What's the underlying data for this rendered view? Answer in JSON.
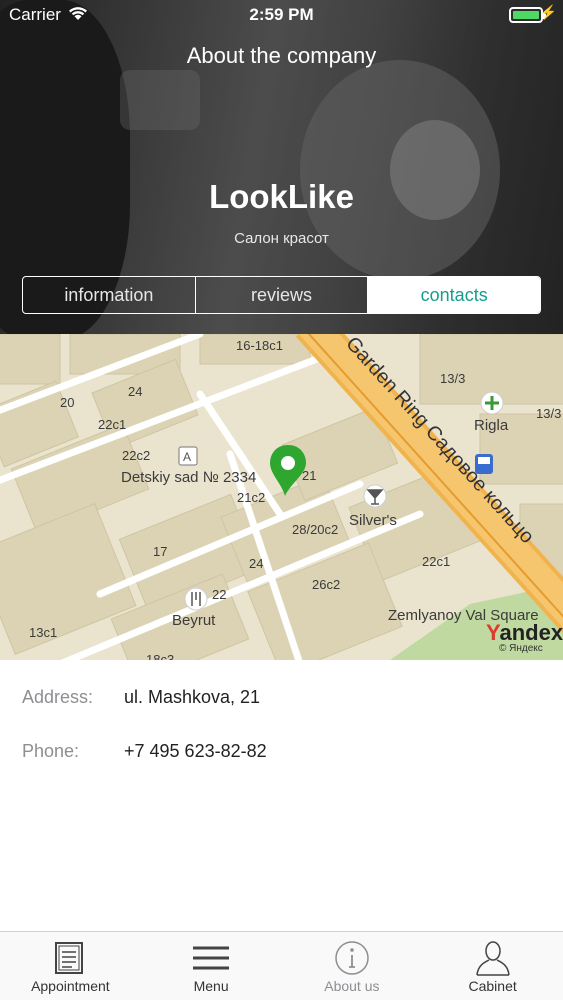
{
  "status_bar": {
    "carrier": "Carrier",
    "time": "2:59 PM",
    "battery_color": "#4cd964"
  },
  "nav": {
    "title": "About the company"
  },
  "company": {
    "name": "LookLike",
    "subtitle": "Салон красот"
  },
  "segments": [
    {
      "label": "information",
      "active": false
    },
    {
      "label": "reviews",
      "active": false
    },
    {
      "label": "contacts",
      "active": true
    }
  ],
  "accent_color": "#139e8e",
  "map": {
    "labels": [
      {
        "text": "16-18c1"
      },
      {
        "text": "24"
      },
      {
        "text": "20"
      },
      {
        "text": "22c1"
      },
      {
        "text": "22c2"
      },
      {
        "text": "Detskiy sad № 2334"
      },
      {
        "text": "21"
      },
      {
        "text": "21c2"
      },
      {
        "text": "Silver's"
      },
      {
        "text": "28/20c2"
      },
      {
        "text": "17"
      },
      {
        "text": "24"
      },
      {
        "text": "26c2"
      },
      {
        "text": "22c1"
      },
      {
        "text": "22"
      },
      {
        "text": "Beyrut"
      },
      {
        "text": "13c1"
      },
      {
        "text": "18c3"
      },
      {
        "text": "13/3"
      },
      {
        "text": "Rigla"
      },
      {
        "text": "13/3"
      },
      {
        "text": "Zemlyanoy Val Square"
      },
      {
        "text": "Detskiy sad"
      }
    ],
    "street_label": "Garden Ring Садовое кольцо",
    "street_label_top": "Detskiy sad",
    "brand": "Yandex",
    "copyright": "© Яндекс",
    "pin_color": "#2fa62f"
  },
  "contacts": {
    "address_label": "Address:",
    "address_value": "ul. Mashkova, 21",
    "phone_label": "Phone:",
    "phone_value": "+7 495 623-82-82"
  },
  "tabbar": [
    {
      "label": "Appointment",
      "icon": "document-list-icon"
    },
    {
      "label": "Menu",
      "icon": "hamburger-menu-icon"
    },
    {
      "label": "About us",
      "icon": "info-circle-icon",
      "muted": true
    },
    {
      "label": "Cabinet",
      "icon": "person-icon"
    }
  ]
}
